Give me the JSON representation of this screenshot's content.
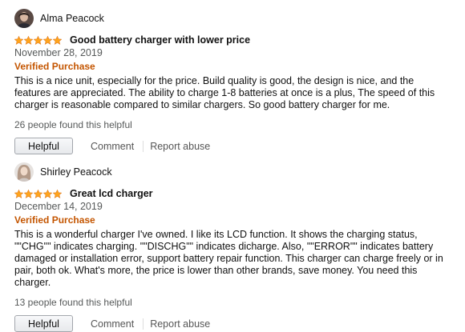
{
  "reviews": [
    {
      "profile_name": "Alma Peacock",
      "avatar_icon": "user-avatar-photo",
      "rating": 5,
      "title": "Good battery charger with lower price",
      "date": "November 28, 2019",
      "verified": "Verified Purchase",
      "body": "This is a nice unit, especially for the price. Build quality is good, the design is nice, and the features are appreciated. The ability to charge 1-8 batteries at once is a plus, The speed of this charger is reasonable compared to similar chargers. So good battery charger for me.",
      "helpful_count": "26 people found this helpful",
      "helpful_label": "Helpful",
      "comment_label": "Comment",
      "report_label": "Report abuse"
    },
    {
      "profile_name": "Shirley Peacock",
      "avatar_icon": "user-avatar-photo",
      "rating": 5,
      "title": "Great lcd charger",
      "date": "December 14, 2019",
      "verified": "Verified Purchase",
      "body": "This is a wonderful charger I've owned. I like its LCD function. It shows the charging status, \"\"CHG\"\" indicates charging. \"\"DISCHG\"\" indicates dicharge. Also, \"\"ERROR\"\" indicates battery damaged or installation error, support battery repair function. This charger can charge freely or in pair, both ok. What's more, the price is lower than other brands, save money. You need this charger.",
      "helpful_count": "13 people found this helpful",
      "helpful_label": "Helpful",
      "comment_label": "Comment",
      "report_label": "Report abuse"
    }
  ],
  "colors": {
    "star": "#ffa41c",
    "verified": "#c45500",
    "link": "#555555"
  }
}
